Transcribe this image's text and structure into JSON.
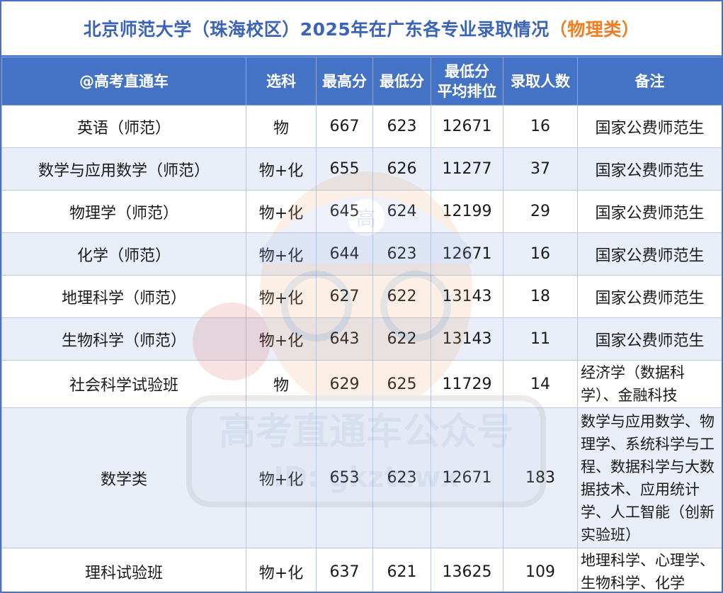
{
  "title": {
    "main": "北京师范大学（珠海校区）2025年在广东各专业录取情况",
    "category": "（物理类）"
  },
  "headers": {
    "major": "@高考直通车",
    "subject": "选科",
    "max": "最高分",
    "min": "最低分",
    "rank_line1": "最低分",
    "rank_line2": "平均排位",
    "count": "录取人数",
    "note": "备注"
  },
  "rows": [
    {
      "major": "英语（师范）",
      "subject": "物",
      "max": "667",
      "min": "623",
      "rank": "12671",
      "count": "16",
      "note": "国家公费师范生"
    },
    {
      "major": "数学与应用数学（师范）",
      "subject": "物+化",
      "max": "655",
      "min": "626",
      "rank": "11277",
      "count": "37",
      "note": "国家公费师范生"
    },
    {
      "major": "物理学（师范）",
      "subject": "物+化",
      "max": "645",
      "min": "624",
      "rank": "12199",
      "count": "29",
      "note": "国家公费师范生"
    },
    {
      "major": "化学（师范）",
      "subject": "物+化",
      "max": "644",
      "min": "623",
      "rank": "12671",
      "count": "16",
      "note": "国家公费师范生"
    },
    {
      "major": "地理科学（师范）",
      "subject": "物+化",
      "max": "627",
      "min": "622",
      "rank": "13143",
      "count": "18",
      "note": "国家公费师范生"
    },
    {
      "major": "生物科学（师范）",
      "subject": "物+化",
      "max": "643",
      "min": "622",
      "rank": "13143",
      "count": "11",
      "note": "国家公费师范生"
    },
    {
      "major": "社会科学试验班",
      "subject": "物",
      "max": "629",
      "min": "625",
      "rank": "11729",
      "count": "14",
      "note": "经济学（数据科学）、金融科技"
    },
    {
      "major": "数学类",
      "subject": "物+化",
      "max": "653",
      "min": "623",
      "rank": "12671",
      "count": "183",
      "note": "数学与应用数学、物理学、系统科学与工程、数据科学与大数据技术、应用统计学、人工智能（创新实验班）"
    },
    {
      "major": "理科试验班",
      "subject": "物+化",
      "max": "637",
      "min": "621",
      "rank": "13625",
      "count": "109",
      "note": "地理科学、心理学、生物科学、化学"
    }
  ],
  "watermark": {
    "text": "高考直通车公众号",
    "id_text": "ID: gkztcwx",
    "badge": "高"
  }
}
